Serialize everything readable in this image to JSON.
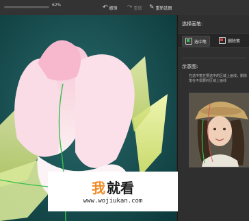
{
  "toolbar": {
    "zoom_value": "62%",
    "undo_label": "撤销",
    "redo_label": "重做",
    "repaint_label": "重新选图"
  },
  "panel": {
    "select_brush_label": "选择画笔:",
    "brush_keep_label": "选中笔",
    "brush_remove_label": "删除笔",
    "example_label": "示意图:",
    "example_text": "在选中笔在要选中的区域上画线，删除笔在不需要的区域上画线"
  },
  "watermark": {
    "char1": "我",
    "char2": "就看",
    "url": "www.wojiukan.com"
  },
  "colors": {
    "keep_line": "#35c04b",
    "remove_line": "#d94444",
    "accent_watermark": "#f08a24"
  }
}
